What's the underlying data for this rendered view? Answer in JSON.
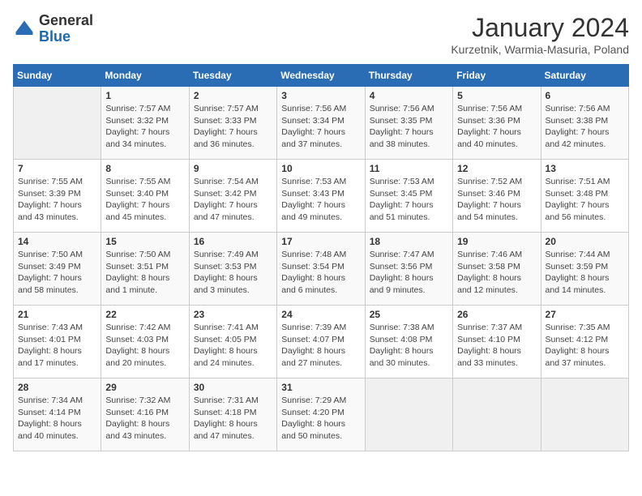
{
  "header": {
    "logo_general": "General",
    "logo_blue": "Blue",
    "month_title": "January 2024",
    "subtitle": "Kurzetnik, Warmia-Masuria, Poland"
  },
  "weekdays": [
    "Sunday",
    "Monday",
    "Tuesday",
    "Wednesday",
    "Thursday",
    "Friday",
    "Saturday"
  ],
  "weeks": [
    [
      {
        "day": "",
        "sunrise": "",
        "sunset": "",
        "daylight": ""
      },
      {
        "day": "1",
        "sunrise": "Sunrise: 7:57 AM",
        "sunset": "Sunset: 3:32 PM",
        "daylight": "Daylight: 7 hours and 34 minutes."
      },
      {
        "day": "2",
        "sunrise": "Sunrise: 7:57 AM",
        "sunset": "Sunset: 3:33 PM",
        "daylight": "Daylight: 7 hours and 36 minutes."
      },
      {
        "day": "3",
        "sunrise": "Sunrise: 7:56 AM",
        "sunset": "Sunset: 3:34 PM",
        "daylight": "Daylight: 7 hours and 37 minutes."
      },
      {
        "day": "4",
        "sunrise": "Sunrise: 7:56 AM",
        "sunset": "Sunset: 3:35 PM",
        "daylight": "Daylight: 7 hours and 38 minutes."
      },
      {
        "day": "5",
        "sunrise": "Sunrise: 7:56 AM",
        "sunset": "Sunset: 3:36 PM",
        "daylight": "Daylight: 7 hours and 40 minutes."
      },
      {
        "day": "6",
        "sunrise": "Sunrise: 7:56 AM",
        "sunset": "Sunset: 3:38 PM",
        "daylight": "Daylight: 7 hours and 42 minutes."
      }
    ],
    [
      {
        "day": "7",
        "sunrise": "Sunrise: 7:55 AM",
        "sunset": "Sunset: 3:39 PM",
        "daylight": "Daylight: 7 hours and 43 minutes."
      },
      {
        "day": "8",
        "sunrise": "Sunrise: 7:55 AM",
        "sunset": "Sunset: 3:40 PM",
        "daylight": "Daylight: 7 hours and 45 minutes."
      },
      {
        "day": "9",
        "sunrise": "Sunrise: 7:54 AM",
        "sunset": "Sunset: 3:42 PM",
        "daylight": "Daylight: 7 hours and 47 minutes."
      },
      {
        "day": "10",
        "sunrise": "Sunrise: 7:53 AM",
        "sunset": "Sunset: 3:43 PM",
        "daylight": "Daylight: 7 hours and 49 minutes."
      },
      {
        "day": "11",
        "sunrise": "Sunrise: 7:53 AM",
        "sunset": "Sunset: 3:45 PM",
        "daylight": "Daylight: 7 hours and 51 minutes."
      },
      {
        "day": "12",
        "sunrise": "Sunrise: 7:52 AM",
        "sunset": "Sunset: 3:46 PM",
        "daylight": "Daylight: 7 hours and 54 minutes."
      },
      {
        "day": "13",
        "sunrise": "Sunrise: 7:51 AM",
        "sunset": "Sunset: 3:48 PM",
        "daylight": "Daylight: 7 hours and 56 minutes."
      }
    ],
    [
      {
        "day": "14",
        "sunrise": "Sunrise: 7:50 AM",
        "sunset": "Sunset: 3:49 PM",
        "daylight": "Daylight: 7 hours and 58 minutes."
      },
      {
        "day": "15",
        "sunrise": "Sunrise: 7:50 AM",
        "sunset": "Sunset: 3:51 PM",
        "daylight": "Daylight: 8 hours and 1 minute."
      },
      {
        "day": "16",
        "sunrise": "Sunrise: 7:49 AM",
        "sunset": "Sunset: 3:53 PM",
        "daylight": "Daylight: 8 hours and 3 minutes."
      },
      {
        "day": "17",
        "sunrise": "Sunrise: 7:48 AM",
        "sunset": "Sunset: 3:54 PM",
        "daylight": "Daylight: 8 hours and 6 minutes."
      },
      {
        "day": "18",
        "sunrise": "Sunrise: 7:47 AM",
        "sunset": "Sunset: 3:56 PM",
        "daylight": "Daylight: 8 hours and 9 minutes."
      },
      {
        "day": "19",
        "sunrise": "Sunrise: 7:46 AM",
        "sunset": "Sunset: 3:58 PM",
        "daylight": "Daylight: 8 hours and 12 minutes."
      },
      {
        "day": "20",
        "sunrise": "Sunrise: 7:44 AM",
        "sunset": "Sunset: 3:59 PM",
        "daylight": "Daylight: 8 hours and 14 minutes."
      }
    ],
    [
      {
        "day": "21",
        "sunrise": "Sunrise: 7:43 AM",
        "sunset": "Sunset: 4:01 PM",
        "daylight": "Daylight: 8 hours and 17 minutes."
      },
      {
        "day": "22",
        "sunrise": "Sunrise: 7:42 AM",
        "sunset": "Sunset: 4:03 PM",
        "daylight": "Daylight: 8 hours and 20 minutes."
      },
      {
        "day": "23",
        "sunrise": "Sunrise: 7:41 AM",
        "sunset": "Sunset: 4:05 PM",
        "daylight": "Daylight: 8 hours and 24 minutes."
      },
      {
        "day": "24",
        "sunrise": "Sunrise: 7:39 AM",
        "sunset": "Sunset: 4:07 PM",
        "daylight": "Daylight: 8 hours and 27 minutes."
      },
      {
        "day": "25",
        "sunrise": "Sunrise: 7:38 AM",
        "sunset": "Sunset: 4:08 PM",
        "daylight": "Daylight: 8 hours and 30 minutes."
      },
      {
        "day": "26",
        "sunrise": "Sunrise: 7:37 AM",
        "sunset": "Sunset: 4:10 PM",
        "daylight": "Daylight: 8 hours and 33 minutes."
      },
      {
        "day": "27",
        "sunrise": "Sunrise: 7:35 AM",
        "sunset": "Sunset: 4:12 PM",
        "daylight": "Daylight: 8 hours and 37 minutes."
      }
    ],
    [
      {
        "day": "28",
        "sunrise": "Sunrise: 7:34 AM",
        "sunset": "Sunset: 4:14 PM",
        "daylight": "Daylight: 8 hours and 40 minutes."
      },
      {
        "day": "29",
        "sunrise": "Sunrise: 7:32 AM",
        "sunset": "Sunset: 4:16 PM",
        "daylight": "Daylight: 8 hours and 43 minutes."
      },
      {
        "day": "30",
        "sunrise": "Sunrise: 7:31 AM",
        "sunset": "Sunset: 4:18 PM",
        "daylight": "Daylight: 8 hours and 47 minutes."
      },
      {
        "day": "31",
        "sunrise": "Sunrise: 7:29 AM",
        "sunset": "Sunset: 4:20 PM",
        "daylight": "Daylight: 8 hours and 50 minutes."
      },
      {
        "day": "",
        "sunrise": "",
        "sunset": "",
        "daylight": ""
      },
      {
        "day": "",
        "sunrise": "",
        "sunset": "",
        "daylight": ""
      },
      {
        "day": "",
        "sunrise": "",
        "sunset": "",
        "daylight": ""
      }
    ]
  ]
}
